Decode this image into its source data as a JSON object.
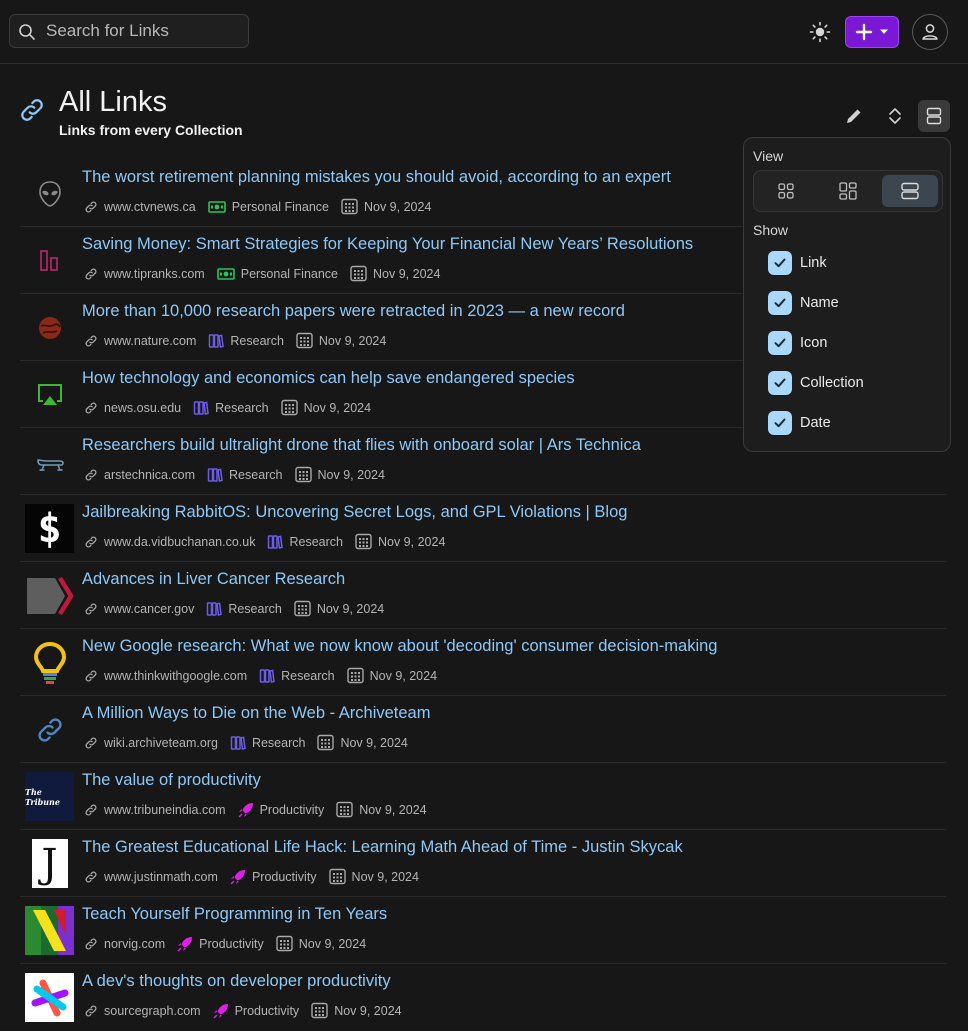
{
  "header": {
    "search_placeholder": "Search for Links",
    "search_icon": "search-icon",
    "theme_icon": "sun-icon",
    "add_icon": "plus-icon",
    "user_icon": "user-icon",
    "accent_color": "#7a18d6"
  },
  "page": {
    "title": "All Links",
    "subtitle": "Links from every Collection",
    "icon": "link-icon"
  },
  "toolbar": {
    "edit_icon": "pencil-icon",
    "sort_icon": "sort-icon",
    "view_icon": "list-view-icon"
  },
  "view_menu": {
    "view_label": "View",
    "show_label": "Show",
    "modes": [
      "card-view-icon",
      "masonry-view-icon",
      "list-view-icon"
    ],
    "active_mode": "list",
    "options": [
      {
        "label": "Link",
        "checked": true
      },
      {
        "label": "Name",
        "checked": true
      },
      {
        "label": "Icon",
        "checked": true
      },
      {
        "label": "Collection",
        "checked": true
      },
      {
        "label": "Date",
        "checked": true
      }
    ]
  },
  "links": [
    {
      "title": "The worst retirement planning mistakes you should avoid, according to an expert",
      "domain": "www.ctvnews.ca",
      "collection": "Personal Finance",
      "date": "Nov 9, 2024",
      "favicon": "alien-icon"
    },
    {
      "title": "Saving Money: Smart Strategies for Keeping Your Financial New Years’ Resolutions",
      "domain": "www.tipranks.com",
      "collection": "Personal Finance",
      "date": "Nov 9, 2024",
      "favicon": "bars-icon"
    },
    {
      "title": "More than 10,000 research papers were retracted in 2023 — a new record",
      "domain": "www.nature.com",
      "collection": "Research",
      "date": "Nov 9, 2024",
      "favicon": "nature-icon"
    },
    {
      "title": "How technology and economics can help save endangered species",
      "domain": "news.osu.edu",
      "collection": "Research",
      "date": "Nov 9, 2024",
      "favicon": "airplay-icon"
    },
    {
      "title": "Researchers build ultralight drone that flies with onboard solar | Ars Technica",
      "domain": "arstechnica.com",
      "collection": "Research",
      "date": "Nov 9, 2024",
      "favicon": "drone-icon"
    },
    {
      "title": "Jailbreaking RabbitOS: Uncovering Secret Logs, and GPL Violations | Blog",
      "domain": "www.da.vidbuchanan.co.uk",
      "collection": "Research",
      "date": "Nov 9, 2024",
      "favicon": "dollar-icon"
    },
    {
      "title": "Advances in Liver Cancer Research",
      "domain": "www.cancer.gov",
      "collection": "Research",
      "date": "Nov 9, 2024",
      "favicon": "chevron-logo-icon"
    },
    {
      "title": "New Google research: What we now know about 'decoding' consumer decision-making",
      "domain": "www.thinkwithgoogle.com",
      "collection": "Research",
      "date": "Nov 9, 2024",
      "favicon": "lightbulb-icon"
    },
    {
      "title": "A Million Ways to Die on the Web - Archiveteam",
      "domain": "wiki.archiveteam.org",
      "collection": "Research",
      "date": "Nov 9, 2024",
      "favicon": "link-icon"
    },
    {
      "title": "The value of productivity",
      "domain": "www.tribuneindia.com",
      "collection": "Productivity",
      "date": "Nov 9, 2024",
      "favicon": "tribune-logo-icon"
    },
    {
      "title": "The Greatest Educational Life Hack: Learning Math Ahead of Time - Justin Skycak",
      "domain": "www.justinmath.com",
      "collection": "Productivity",
      "date": "Nov 9, 2024",
      "favicon": "j-logo-icon"
    },
    {
      "title": "Teach Yourself Programming in Ten Years",
      "domain": "norvig.com",
      "collection": "Productivity",
      "date": "Nov 9, 2024",
      "favicon": "n-logo-icon"
    },
    {
      "title": "A dev's thoughts on developer productivity",
      "domain": "sourcegraph.com",
      "collection": "Productivity",
      "date": "Nov 9, 2024",
      "favicon": "sourcegraph-icon"
    }
  ],
  "collection_icons": {
    "Personal Finance": "money-icon",
    "Research": "books-icon",
    "Productivity": "rocket-icon"
  },
  "collection_colors": {
    "Personal Finance": "#22c55e",
    "Research": "#6d5ce8",
    "Productivity": "#e11ee8"
  }
}
